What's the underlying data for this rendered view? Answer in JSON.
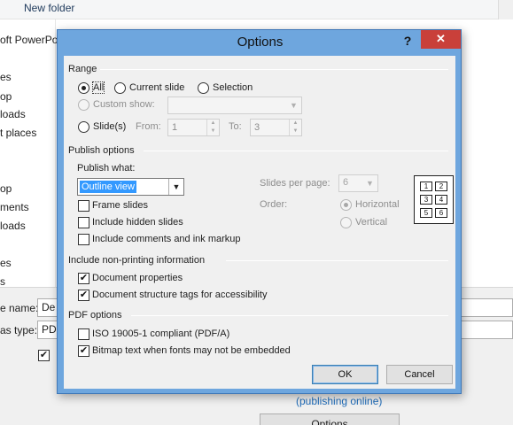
{
  "background": {
    "toolbar": {
      "new_folder": "New folder"
    },
    "sidebar": [
      "oft PowerPo",
      "es",
      "op",
      "loads",
      "t places",
      "op",
      "ments",
      "loads",
      "es",
      "s"
    ],
    "file_name_label": "e name:",
    "file_name_value": "De",
    "save_type_label": "as type:",
    "save_type_value": "PD",
    "checkbox_text": "✔",
    "publishing_link": "(publishing online)",
    "options_button": "Options"
  },
  "dialog": {
    "title": "Options",
    "help": "?",
    "close": "✕",
    "range": {
      "title": "Range",
      "all": "All",
      "current_slide": "Current slide",
      "selection": "Selection",
      "custom_show": "Custom show:",
      "slides": "Slide(s)",
      "from_label": "From:",
      "from_value": "1",
      "to_label": "To:",
      "to_value": "3",
      "selected": "all"
    },
    "publish": {
      "title": "Publish options",
      "publish_what_label": "Publish what:",
      "publish_what_value": "Outline view",
      "frame_slides": "Frame slides",
      "include_hidden": "Include hidden slides",
      "include_comments": "Include comments and ink markup",
      "slides_per_page_label": "Slides per page:",
      "slides_per_page_value": "6",
      "order_label": "Order:",
      "horizontal": "Horizontal",
      "vertical": "Vertical",
      "preview_numbers": [
        "1",
        "2",
        "3",
        "4",
        "5",
        "6"
      ]
    },
    "nonprinting": {
      "title": "Include non-printing information",
      "document_properties": "Document properties",
      "structure_tags": "Document structure tags for accessibility"
    },
    "pdf": {
      "title": "PDF options",
      "iso": "ISO 19005-1 compliant (PDF/A)",
      "bitmap_text": "Bitmap text when fonts may not be embedded"
    },
    "check_mark": "✔",
    "arrow_down": "▼",
    "spin_up": "▲",
    "spin_down": "▼",
    "ok": "OK",
    "cancel": "Cancel"
  },
  "colors": {
    "dialog_frame": "#6ea6de",
    "close_button": "#c9403a",
    "selection_highlight": "#3399ff",
    "link": "#1e6bb8"
  }
}
